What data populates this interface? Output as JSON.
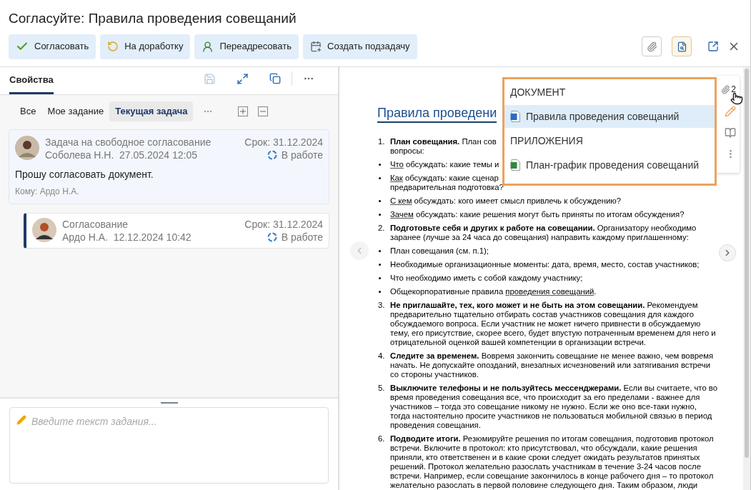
{
  "title": "Согласуйте: Правила проведения совещаний",
  "actions": [
    {
      "label": "Согласовать",
      "kind": "approve"
    },
    {
      "label": "На доработку",
      "kind": "rework"
    },
    {
      "label": "Переадресовать",
      "kind": "forward"
    },
    {
      "label": "Создать подзадачу",
      "kind": "subtask"
    }
  ],
  "view_toggles": [
    {
      "kind": "attachments",
      "selected": false
    },
    {
      "kind": "preview",
      "selected": true
    }
  ],
  "panel_tabs": [
    {
      "label": "Свойства",
      "selected": true
    }
  ],
  "filters": [
    {
      "label": "Все",
      "selected": false
    },
    {
      "label": "Мое задание",
      "selected": false
    },
    {
      "label": "Текущая задача",
      "selected": true
    }
  ],
  "tasks": [
    {
      "title": "Задача на свободное согласование",
      "author": "Соболева Н.Н.",
      "date": "27.05.2024 12:05",
      "due": "Срок: 31.12.2024",
      "status": "В работе",
      "message": "Прошу согласовать документ.",
      "recipient": "Кому: Ардо Н.А.",
      "children": [
        {
          "title": "Согласование",
          "author": "Ардо Н.А.",
          "date": "12.12.2024 10:42",
          "due": "Срок: 31.12.2024",
          "status": "В работе"
        }
      ]
    }
  ],
  "task_input": {
    "placeholder": "Введите текст задания..."
  },
  "attachment_count": "2",
  "popup": {
    "sections": [
      {
        "heading": "ДОКУМЕНТ",
        "files": [
          {
            "name": "Правила проведения совещаний",
            "kind": "word",
            "selected": true
          }
        ]
      },
      {
        "heading": "ПРИЛОЖЕНИЯ",
        "files": [
          {
            "name": "План-график проведения совещаний",
            "kind": "excel",
            "selected": false
          }
        ]
      }
    ]
  },
  "document": {
    "heading": "Правила проведени",
    "blocks": [
      {
        "kind": "numbered",
        "number": "1.",
        "lines": [
          "**План совещания.** План сов",
          "вопросы:"
        ]
      },
      {
        "kind": "bullet",
        "lines": [
          [
            {
              "text": "Что",
              "underlined": true
            },
            {
              "text": " обсуждать: какие темы и",
              "underlined": false
            }
          ]
        ]
      },
      {
        "kind": "bullet",
        "lines": [
          [
            {
              "text": "Как",
              "underlined": true
            },
            {
              "text": " обсуждать: какие сценар",
              "underlined": false
            }
          ],
          [
            {
              "text": "предварительная подготовка?",
              "underlined": false
            }
          ]
        ]
      },
      {
        "kind": "bullet",
        "lines": [
          [
            {
              "text": "С кем",
              "underlined": true
            },
            {
              "text": " обсуждать: кого имеет смысл привлечь к обсуждению?",
              "underlined": false
            }
          ]
        ]
      },
      {
        "kind": "bullet",
        "lines": [
          [
            {
              "text": "Зачем",
              "underlined": true
            },
            {
              "text": " обсуждать: какие решения могут быть приняты по итогам обсуждения?",
              "underlined": false
            }
          ]
        ]
      },
      {
        "kind": "numbered",
        "number": "2.",
        "text": "**Подготовьте себя и других к работе на совещании.** Организатору необходимо заранее (лучше за 24 часа до совещания) направить каждому приглашенному:"
      },
      {
        "kind": "bullet",
        "lines": [
          [
            {
              "text": "План совещания (см. п.1);",
              "underlined": false
            }
          ]
        ]
      },
      {
        "kind": "bullet",
        "lines": [
          [
            {
              "text": "Необходимые организационные моменты: дата, время, место, состав участников;",
              "underlined": false
            }
          ]
        ]
      },
      {
        "kind": "bullet",
        "lines": [
          [
            {
              "text": "Что необходимо иметь с собой каждому участнику;",
              "underlined": false
            }
          ]
        ]
      },
      {
        "kind": "bullet",
        "lines": [
          [
            {
              "text": "Общекорпоративные правила ",
              "underlined": false
            },
            {
              "text": "проведения совещаний",
              "underlined": true
            },
            {
              "text": ".",
              "underlined": false
            }
          ]
        ]
      },
      {
        "kind": "numbered",
        "number": "3.",
        "text": "**Не приглашайте, тех, кого может и не быть на этом совещании.** Рекомендуем предварительно тщательно отбирать состав участников совещания для каждого обсуждаемого вопроса. Если участник не может ничего привнести в обсуждаемую тему, его присутствие, скорее всего, будет впустую потраченным временем для него и отрицательной оценкой вашей компетенции в организации встречи."
      },
      {
        "kind": "numbered",
        "number": "4.",
        "text": "**Следите за временем.** Вовремя закончить совещание не менее важно, чем вовремя начать. Не допускайте опозданий, внезапных исчезновений или затягивания встречи со стороны участников."
      },
      {
        "kind": "numbered",
        "number": "5.",
        "text": "**Выключите телефоны и не пользуйтесь мессенджерами.** Если вы считаете, что во время проведения совещания все, что происходит за его пределами - важнее для участников – тогда это совещание никому не нужно. Если же оно все-таки нужно, тогда настоятельно просите участников не пользоваться мобильной связью в период проведения совещания."
      },
      {
        "kind": "numbered",
        "number": "6.",
        "text": "**Подводите итоги.** Резюмируйте решения по итогам совещания, подготовив протокол встречи. Включите в протокол: кто присутствовал, что обсуждали, какие решения приняли, кто ответственен и в какие сроки следует ожидать результатов принятых решений. Протокол желательно разослать участникам в течение 3-24 часов после встречи. Например, если совещание закончилось в конце рабочего дня – то протокол желательно разослать в первой половине следующего дня. Таким образом, люди"
      }
    ]
  }
}
